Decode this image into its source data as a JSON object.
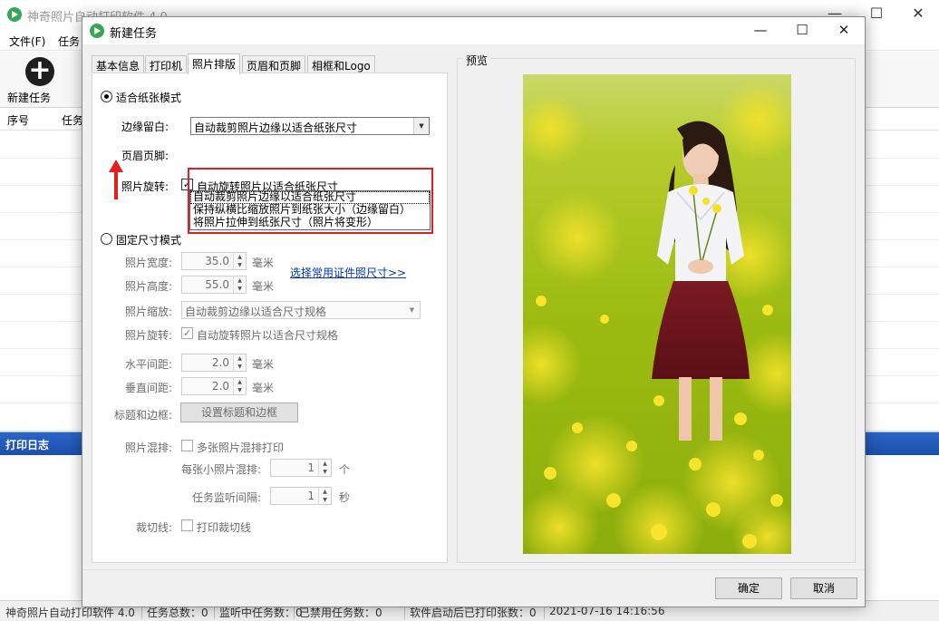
{
  "main_window": {
    "title": "神奇照片自动打印软件 4.0",
    "menu": [
      "文件(F)",
      "任务"
    ],
    "toolbar": {
      "new_task_label": "新建任务"
    },
    "table_headers": [
      "序号",
      "任务"
    ],
    "log_title": "打印日志",
    "statusbar": {
      "app": "神奇照片自动打印软件 4.0",
      "total_tasks": "任务总数：0",
      "listening": "监听中任务数：0",
      "disabled": "已禁用任务数：0",
      "printed_since_start": "软件启动后已打印张数：0",
      "time": "2021-07-16 14:16:56"
    }
  },
  "dialog": {
    "title": "新建任务",
    "tabs": [
      "基本信息",
      "打印机",
      "照片排版",
      "页眉和页脚",
      "相框和Logo"
    ],
    "active_tab": "照片排版",
    "fit_mode": {
      "label": "适合纸张模式",
      "selected": true,
      "margin_label": "边缘留白:",
      "margin_value": "自动裁剪照片边缘以适合纸张尺寸",
      "margin_options": [
        "自动裁剪照片边缘以适合纸张尺寸",
        "保持纵横比缩放照片到纸张大小（边缘留白）",
        "将照片拉伸到纸张尺寸（照片将变形）"
      ],
      "header_footer_label": "页眉页脚:",
      "rotate_label": "照片旋转:",
      "rotate_checkbox": "自动旋转照片以适合纸张尺寸",
      "rotate_checked": true
    },
    "fixed_mode": {
      "label": "固定尺寸模式",
      "selected": false,
      "width_label": "照片宽度:",
      "width_value": "35.0",
      "height_label": "照片高度:",
      "height_value": "55.0",
      "unit_mm": "毫米",
      "id_photo_link": "选择常用证件照尺寸>>",
      "scale_label": "照片缩放:",
      "scale_value": "自动裁剪边缘以适合尺寸规格",
      "rotate_label": "照片旋转:",
      "rotate_checkbox": "自动旋转照片以适合尺寸规格",
      "rotate_checked": true,
      "hspace_label": "水平间距:",
      "hspace_value": "2.0",
      "vspace_label": "垂直间距:",
      "vspace_value": "2.0",
      "title_border_label": "标题和边框:",
      "title_border_button": "设置标题和边框"
    },
    "mix": {
      "label": "照片混排:",
      "checkbox": "多张照片混排打印",
      "per_sheet_label": "每张小照片混排:",
      "per_sheet_value": "1",
      "per_sheet_unit": "个",
      "interval_label": "任务监听间隔:",
      "interval_value": "1",
      "interval_unit": "秒"
    },
    "cut_line": {
      "label": "裁切线:",
      "checkbox": "打印裁切线"
    },
    "preview_label": "预览",
    "ok_button": "确定",
    "cancel_button": "取消"
  },
  "colors": {
    "highlight_box": "#e02020",
    "link": "#0033cc",
    "log_header": "#2b65c7"
  }
}
